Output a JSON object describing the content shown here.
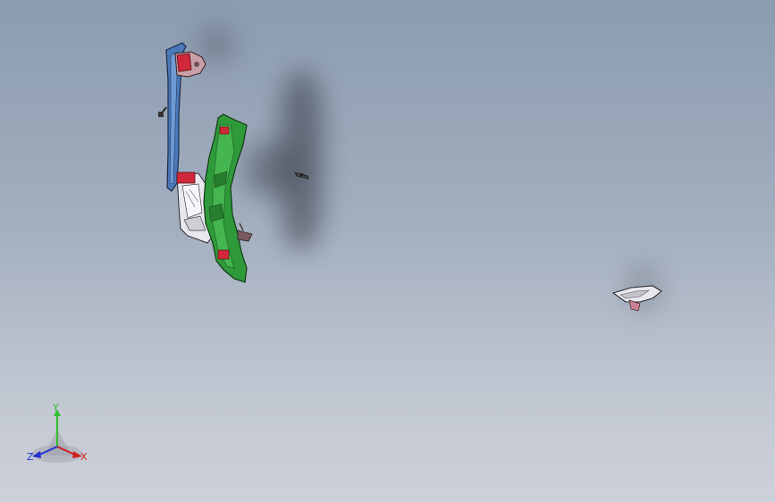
{
  "view": {
    "background_top": "#8c9bb0",
    "background_bottom": "#cdd1d9"
  },
  "model_parts": [
    {
      "name": "upper-rail",
      "color": "#4a78b8"
    },
    {
      "name": "pillar-panel",
      "color": "#2f9a3a"
    },
    {
      "name": "brackets",
      "color": "#d0283a"
    },
    {
      "name": "bracket-part",
      "color": "#e8e8ee"
    }
  ],
  "triad": {
    "y_label": "Y",
    "x_label": "X",
    "z_label": "Z",
    "y_color": "#2fbf2f",
    "x_color": "#d02020",
    "z_color": "#2030d0"
  }
}
